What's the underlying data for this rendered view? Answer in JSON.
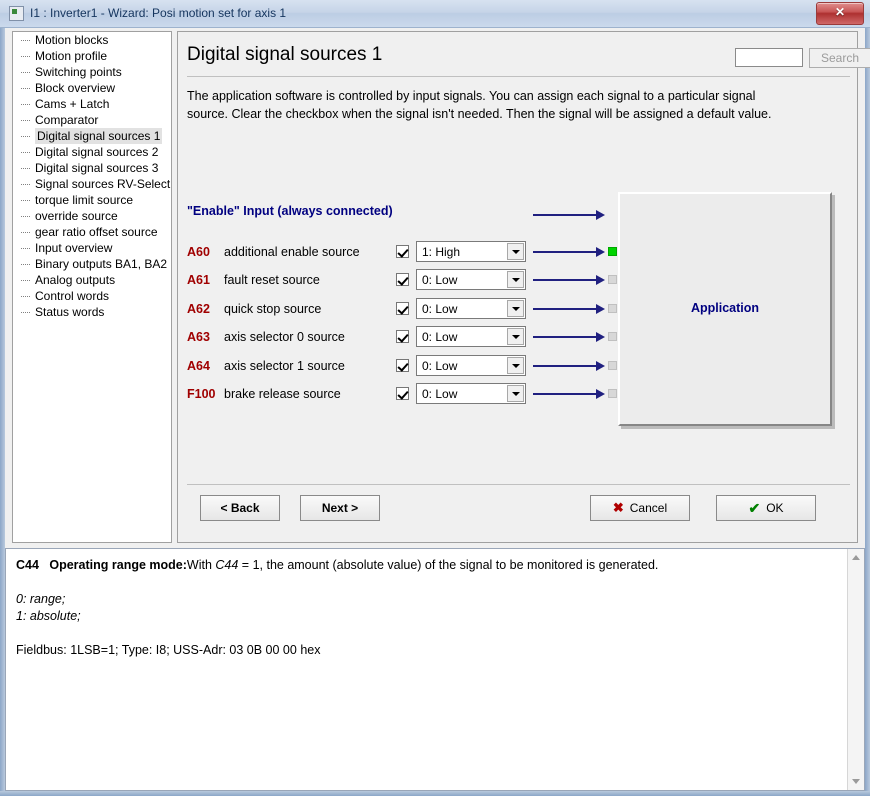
{
  "window": {
    "title": "I1 : Inverter1 - Wizard: Posi motion set for axis 1",
    "close_label": "x"
  },
  "sidebar": {
    "items": [
      {
        "label": "Motion blocks",
        "selected": false
      },
      {
        "label": "Motion profile",
        "selected": false
      },
      {
        "label": "Switching points",
        "selected": false
      },
      {
        "label": "Block overview",
        "selected": false
      },
      {
        "label": "Cams + Latch",
        "selected": false
      },
      {
        "label": "Comparator",
        "selected": false
      },
      {
        "label": "Digital signal sources 1",
        "selected": true
      },
      {
        "label": "Digital signal sources 2",
        "selected": false
      },
      {
        "label": "Digital signal sources 3",
        "selected": false
      },
      {
        "label": "Signal sources RV-Select",
        "selected": false
      },
      {
        "label": "torque limit source",
        "selected": false
      },
      {
        "label": "override source",
        "selected": false
      },
      {
        "label": "gear ratio offset source",
        "selected": false
      },
      {
        "label": "Input overview",
        "selected": false
      },
      {
        "label": "Binary outputs BA1, BA2",
        "selected": false
      },
      {
        "label": "Analog outputs",
        "selected": false
      },
      {
        "label": "Control words",
        "selected": false
      },
      {
        "label": "Status words",
        "selected": false
      }
    ]
  },
  "page": {
    "title": "Digital signal sources 1",
    "description": "The application software is controlled by input signals. You can assign each signal to a particular signal source. Clear the checkbox when the signal isn't needed. Then the signal will be assigned a default value.",
    "search_value": "",
    "search_placeholder": "",
    "search_button_label": "Search"
  },
  "diagram": {
    "enable_label": "\"Enable\"  Input  (always connected)",
    "application_box_label": "Application",
    "rows": [
      {
        "code": "A60",
        "name": "additional enable source",
        "checked": true,
        "value": "1:  High",
        "led": "on"
      },
      {
        "code": "A61",
        "name": "fault reset source",
        "checked": true,
        "value": "0:  Low",
        "led": "off"
      },
      {
        "code": "A62",
        "name": "quick stop source",
        "checked": true,
        "value": "0:  Low",
        "led": "off"
      },
      {
        "code": "A63",
        "name": "axis selector 0 source",
        "checked": true,
        "value": "0:  Low",
        "led": "off"
      },
      {
        "code": "A64",
        "name": "axis selector 1 source",
        "checked": true,
        "value": "0:  Low",
        "led": "off"
      },
      {
        "code": "F100",
        "name": "brake release source",
        "checked": true,
        "value": "0:  Low",
        "led": "off"
      }
    ]
  },
  "footer": {
    "back_label": "< Back",
    "next_label": "Next >",
    "cancel_label": "Cancel",
    "ok_label": "OK",
    "cancel_icon": "✖",
    "ok_icon": "✔"
  },
  "help": {
    "param": "C44",
    "heading": "Operating range mode:",
    "body": "With ",
    "body_italic": "C44",
    "body_rest": " = 1, the amount (absolute value) of the signal to be monitored is generated.",
    "option_0": "0:  range;",
    "option_1": "1:  absolute;",
    "fieldbus": "Fieldbus: 1LSB=1; Type: I8; USS-Adr: 03 0B 00 00 hex"
  },
  "colors": {
    "param_red": "#a00000",
    "navy": "#000080",
    "led_on": "#00d400",
    "led_off": "#d8d8d8"
  }
}
